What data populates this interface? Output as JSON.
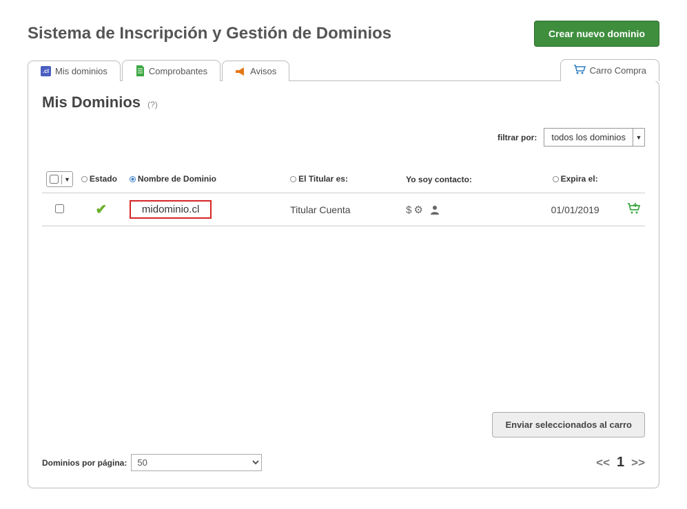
{
  "header": {
    "title": "Sistema de Inscripción y Gestión de Dominios",
    "create_button": "Crear nuevo dominio"
  },
  "tabs": {
    "my_domains": "Mis dominios",
    "receipts": "Comprobantes",
    "notices": "Avisos",
    "cart": "Carro Compra"
  },
  "panel": {
    "heading": "Mis Dominios",
    "help": "(?)"
  },
  "filter": {
    "label": "filtrar por:",
    "selected": "todos los dominios"
  },
  "columns": {
    "status": "Estado",
    "domain": "Nombre de Dominio",
    "holder": "El Titular es:",
    "contact": "Yo soy contacto:",
    "expires": "Expira el:"
  },
  "rows": [
    {
      "domain": "midominio.cl",
      "holder": "Titular Cuenta",
      "expires": "01/01/2019"
    }
  ],
  "actions": {
    "send_to_cart": "Enviar seleccionados al carro"
  },
  "footer": {
    "per_page_label": "Dominios por página:",
    "per_page_value": "50",
    "page_current": "1",
    "prev": "<<",
    "next": ">>"
  }
}
